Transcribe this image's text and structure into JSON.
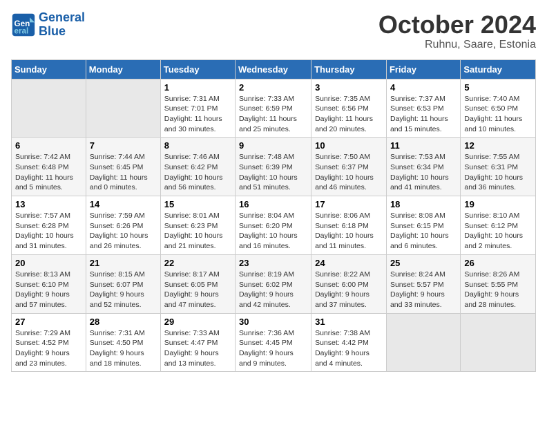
{
  "header": {
    "logo_general": "General",
    "logo_blue": "Blue",
    "month": "October 2024",
    "location": "Ruhnu, Saare, Estonia"
  },
  "weekdays": [
    "Sunday",
    "Monday",
    "Tuesday",
    "Wednesday",
    "Thursday",
    "Friday",
    "Saturday"
  ],
  "weeks": [
    [
      {
        "num": "",
        "info": ""
      },
      {
        "num": "",
        "info": ""
      },
      {
        "num": "1",
        "info": "Sunrise: 7:31 AM\nSunset: 7:01 PM\nDaylight: 11 hours and 30 minutes."
      },
      {
        "num": "2",
        "info": "Sunrise: 7:33 AM\nSunset: 6:59 PM\nDaylight: 11 hours and 25 minutes."
      },
      {
        "num": "3",
        "info": "Sunrise: 7:35 AM\nSunset: 6:56 PM\nDaylight: 11 hours and 20 minutes."
      },
      {
        "num": "4",
        "info": "Sunrise: 7:37 AM\nSunset: 6:53 PM\nDaylight: 11 hours and 15 minutes."
      },
      {
        "num": "5",
        "info": "Sunrise: 7:40 AM\nSunset: 6:50 PM\nDaylight: 11 hours and 10 minutes."
      }
    ],
    [
      {
        "num": "6",
        "info": "Sunrise: 7:42 AM\nSunset: 6:48 PM\nDaylight: 11 hours and 5 minutes."
      },
      {
        "num": "7",
        "info": "Sunrise: 7:44 AM\nSunset: 6:45 PM\nDaylight: 11 hours and 0 minutes."
      },
      {
        "num": "8",
        "info": "Sunrise: 7:46 AM\nSunset: 6:42 PM\nDaylight: 10 hours and 56 minutes."
      },
      {
        "num": "9",
        "info": "Sunrise: 7:48 AM\nSunset: 6:39 PM\nDaylight: 10 hours and 51 minutes."
      },
      {
        "num": "10",
        "info": "Sunrise: 7:50 AM\nSunset: 6:37 PM\nDaylight: 10 hours and 46 minutes."
      },
      {
        "num": "11",
        "info": "Sunrise: 7:53 AM\nSunset: 6:34 PM\nDaylight: 10 hours and 41 minutes."
      },
      {
        "num": "12",
        "info": "Sunrise: 7:55 AM\nSunset: 6:31 PM\nDaylight: 10 hours and 36 minutes."
      }
    ],
    [
      {
        "num": "13",
        "info": "Sunrise: 7:57 AM\nSunset: 6:28 PM\nDaylight: 10 hours and 31 minutes."
      },
      {
        "num": "14",
        "info": "Sunrise: 7:59 AM\nSunset: 6:26 PM\nDaylight: 10 hours and 26 minutes."
      },
      {
        "num": "15",
        "info": "Sunrise: 8:01 AM\nSunset: 6:23 PM\nDaylight: 10 hours and 21 minutes."
      },
      {
        "num": "16",
        "info": "Sunrise: 8:04 AM\nSunset: 6:20 PM\nDaylight: 10 hours and 16 minutes."
      },
      {
        "num": "17",
        "info": "Sunrise: 8:06 AM\nSunset: 6:18 PM\nDaylight: 10 hours and 11 minutes."
      },
      {
        "num": "18",
        "info": "Sunrise: 8:08 AM\nSunset: 6:15 PM\nDaylight: 10 hours and 6 minutes."
      },
      {
        "num": "19",
        "info": "Sunrise: 8:10 AM\nSunset: 6:12 PM\nDaylight: 10 hours and 2 minutes."
      }
    ],
    [
      {
        "num": "20",
        "info": "Sunrise: 8:13 AM\nSunset: 6:10 PM\nDaylight: 9 hours and 57 minutes."
      },
      {
        "num": "21",
        "info": "Sunrise: 8:15 AM\nSunset: 6:07 PM\nDaylight: 9 hours and 52 minutes."
      },
      {
        "num": "22",
        "info": "Sunrise: 8:17 AM\nSunset: 6:05 PM\nDaylight: 9 hours and 47 minutes."
      },
      {
        "num": "23",
        "info": "Sunrise: 8:19 AM\nSunset: 6:02 PM\nDaylight: 9 hours and 42 minutes."
      },
      {
        "num": "24",
        "info": "Sunrise: 8:22 AM\nSunset: 6:00 PM\nDaylight: 9 hours and 37 minutes."
      },
      {
        "num": "25",
        "info": "Sunrise: 8:24 AM\nSunset: 5:57 PM\nDaylight: 9 hours and 33 minutes."
      },
      {
        "num": "26",
        "info": "Sunrise: 8:26 AM\nSunset: 5:55 PM\nDaylight: 9 hours and 28 minutes."
      }
    ],
    [
      {
        "num": "27",
        "info": "Sunrise: 7:29 AM\nSunset: 4:52 PM\nDaylight: 9 hours and 23 minutes."
      },
      {
        "num": "28",
        "info": "Sunrise: 7:31 AM\nSunset: 4:50 PM\nDaylight: 9 hours and 18 minutes."
      },
      {
        "num": "29",
        "info": "Sunrise: 7:33 AM\nSunset: 4:47 PM\nDaylight: 9 hours and 13 minutes."
      },
      {
        "num": "30",
        "info": "Sunrise: 7:36 AM\nSunset: 4:45 PM\nDaylight: 9 hours and 9 minutes."
      },
      {
        "num": "31",
        "info": "Sunrise: 7:38 AM\nSunset: 4:42 PM\nDaylight: 9 hours and 4 minutes."
      },
      {
        "num": "",
        "info": ""
      },
      {
        "num": "",
        "info": ""
      }
    ]
  ]
}
